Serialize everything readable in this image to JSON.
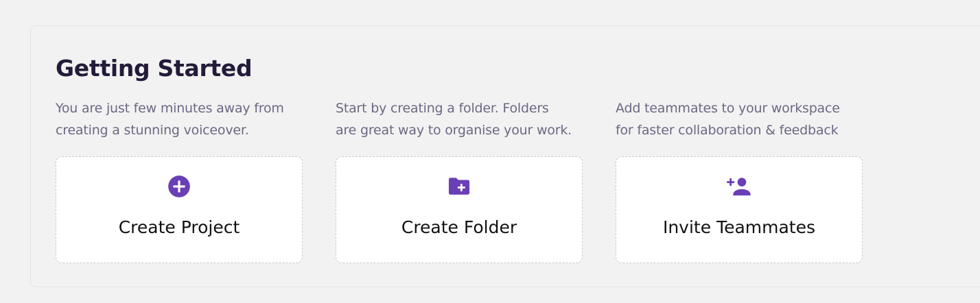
{
  "section": {
    "title": "Getting Started"
  },
  "cards": [
    {
      "description": "You are just few minutes away from\ncreating a stunning voiceover.",
      "label": "Create Project",
      "icon": "plus-circle-icon"
    },
    {
      "description": "Start by creating a folder. Folders\nare great way to organise your work.",
      "label": "Create Folder",
      "icon": "folder-plus-icon"
    },
    {
      "description": "Add teammates to your workspace\nfor faster collaboration & feedback",
      "label": "Invite Teammates",
      "icon": "person-add-icon"
    }
  ],
  "colors": {
    "accent": "#6a3fb5",
    "title": "#241b3a",
    "text": "#6e6783"
  }
}
